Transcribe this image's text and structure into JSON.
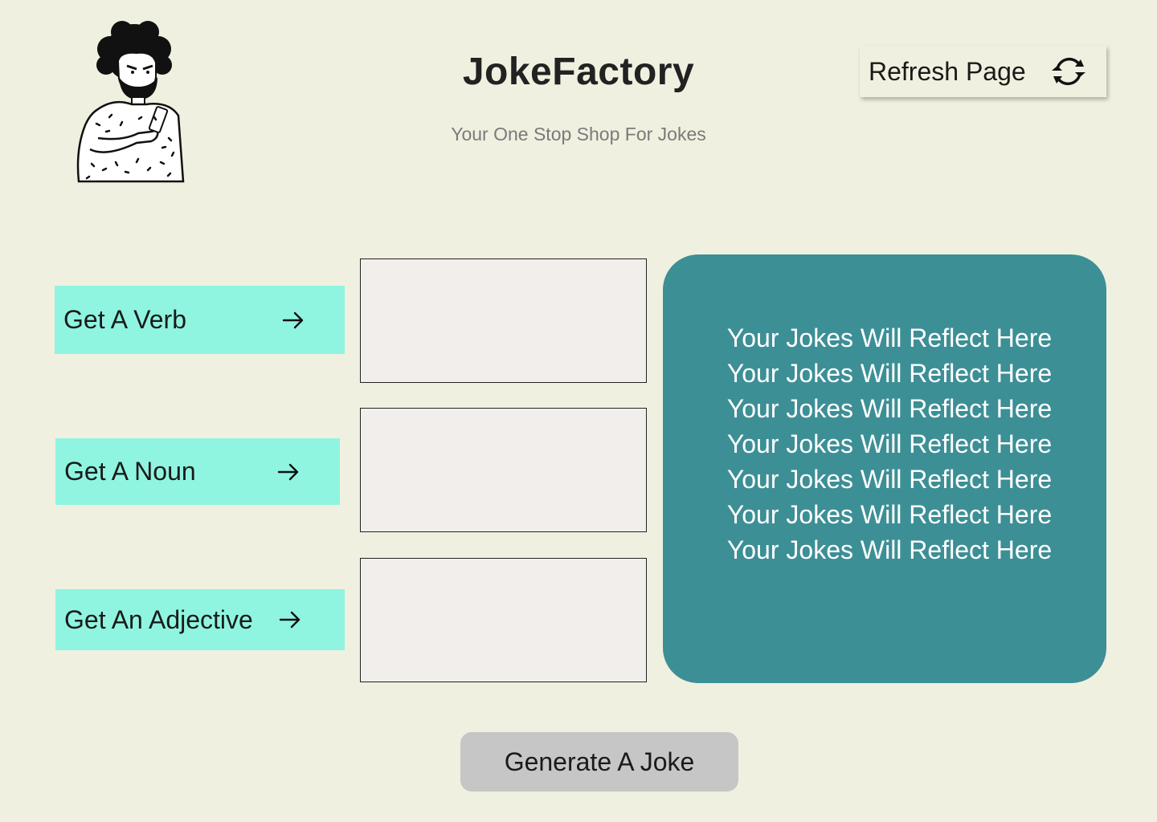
{
  "header": {
    "title": "JokeFactory",
    "subtitle": "Your One Stop Shop For Jokes",
    "refresh_label": "Refresh Page",
    "avatar_icon": "bearded-man-reading-phone-illustration",
    "refresh_icon": "refresh-arrows-icon"
  },
  "word_inputs": [
    {
      "button_label": "Get A Verb",
      "value": "",
      "icon": "arrow-right-icon"
    },
    {
      "button_label": "Get A Noun",
      "value": "",
      "icon": "arrow-right-icon"
    },
    {
      "button_label": "Get An Adjective",
      "value": "",
      "icon": "arrow-right-icon"
    }
  ],
  "joke_panel": {
    "lines": [
      "Your Jokes Will Reflect Here",
      "Your Jokes Will Reflect Here",
      "Your Jokes Will Reflect Here",
      "Your Jokes Will Reflect Here",
      "Your Jokes Will Reflect Here",
      "Your Jokes Will Reflect Here",
      "Your Jokes Will Reflect Here"
    ]
  },
  "generate_label": "Generate A Joke",
  "colors": {
    "background": "#f0f0e0",
    "word_button": "#8ff5e0",
    "joke_panel": "#3d8f96",
    "generate_button": "#c6c6c6",
    "word_box": "#f1eeec"
  }
}
